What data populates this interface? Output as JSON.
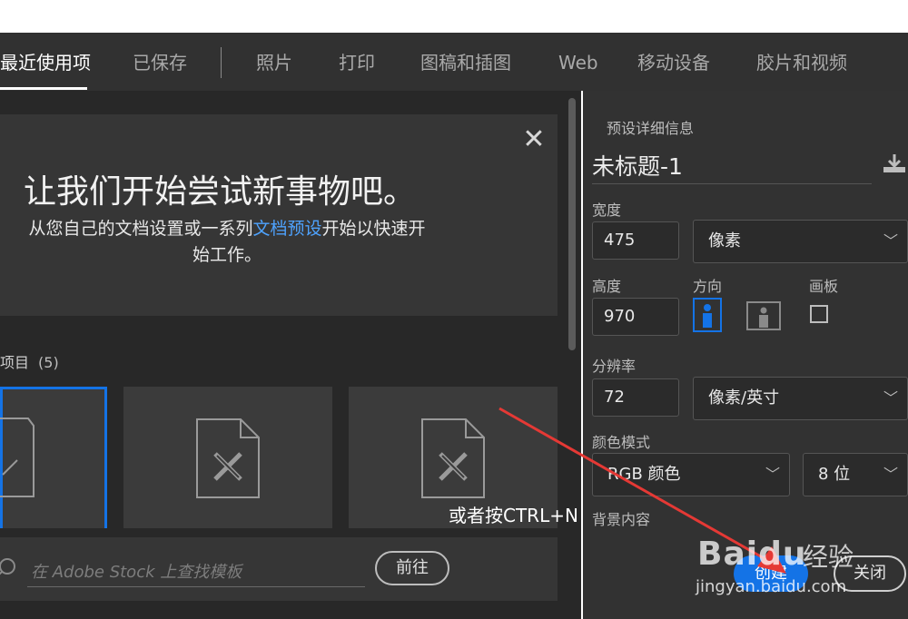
{
  "tabs": [
    {
      "label": "最近使用项",
      "active": true
    },
    {
      "label": "已保存",
      "active": false
    },
    {
      "label": "照片",
      "active": false
    },
    {
      "label": "打印",
      "active": false
    },
    {
      "label": "图稿和插图",
      "active": false
    },
    {
      "label": "Web",
      "active": false
    },
    {
      "label": "移动设备",
      "active": false
    },
    {
      "label": "胶片和视频",
      "active": false
    }
  ],
  "welcome": {
    "title": "让我们开始尝试新事物吧。",
    "desc_before": "从您自己的文档设置或一系列",
    "desc_link": "文档预设",
    "desc_after": "开始以快速开始工作。"
  },
  "recent": {
    "label": "项目",
    "count": "(5)"
  },
  "search": {
    "placeholder": "在 Adobe Stock 上查找模板",
    "go_label": "前往"
  },
  "preset": {
    "header": "预设详细信息",
    "doc_name": "未标题-1",
    "width_label": "宽度",
    "width_value": "475",
    "width_unit": "像素",
    "height_label": "高度",
    "height_value": "970",
    "orientation_label": "方向",
    "artboard_label": "画板",
    "resolution_label": "分辨率",
    "resolution_value": "72",
    "resolution_unit": "像素/英寸",
    "color_mode_label": "颜色模式",
    "color_mode_value": "RGB 颜色",
    "bit_depth_value": "8 位",
    "background_label": "背景内容",
    "create_label": "创建",
    "close_label": "关闭"
  },
  "annotation": {
    "text": "或者按CTRL+N",
    "arrow_color": "#e53935"
  },
  "watermark": {
    "brand": "Baidu",
    "brand_cn": "经验",
    "url": "jingyan.baidu.com"
  },
  "colors": {
    "accent": "#1473e6",
    "link": "#4ea3ff"
  }
}
